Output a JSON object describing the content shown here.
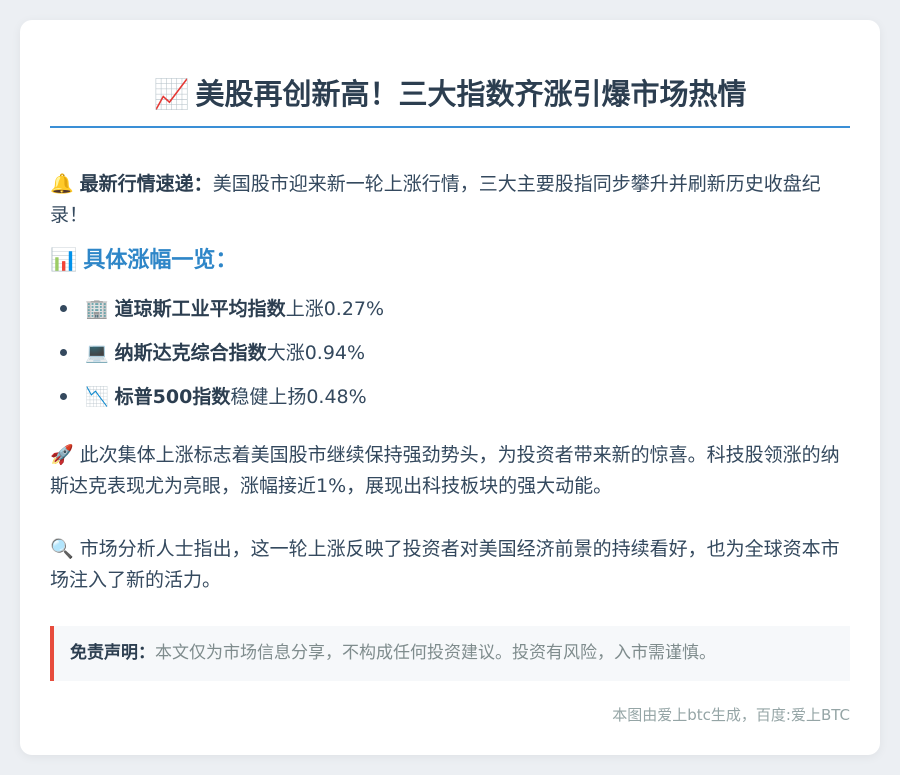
{
  "title": {
    "emoji": "📈",
    "text": "美股再创新高！三大指数齐涨引爆市场热情"
  },
  "intro": {
    "emoji": "🔔",
    "lead": "最新行情速递：",
    "text": "美国股市迎来新一轮上涨行情，三大主要股指同步攀升并刷新历史收盘纪录！"
  },
  "section": {
    "emoji": "📊",
    "heading": "具体涨幅一览："
  },
  "indices": [
    {
      "emoji": "🏢",
      "name": "道琼斯工业平均指数",
      "change": "上涨0.27%"
    },
    {
      "emoji": "💻",
      "name": "纳斯达克综合指数",
      "change": "大涨0.94%"
    },
    {
      "emoji": "📉",
      "name": "标普500指数",
      "change": "稳健上扬0.48%"
    }
  ],
  "paragraph1": {
    "emoji": "🚀",
    "text": "此次集体上涨标志着美国股市继续保持强劲势头，为投资者带来新的惊喜。科技股领涨的纳斯达克表现尤为亮眼，涨幅接近1%，展现出科技板块的强大动能。"
  },
  "paragraph2": {
    "emoji": "🔍",
    "text": "市场分析人士指出，这一轮上涨反映了投资者对美国经济前景的持续看好，也为全球资本市场注入了新的活力。"
  },
  "disclaimer": {
    "label": "免责声明：",
    "text": "本文仅为市场信息分享，不构成任何投资建议。投资有风险，入市需谨慎。"
  },
  "footer": "本图由爱上btc生成，百度:爱上BTC",
  "colors": {
    "accent": "#3a8fd6",
    "section_heading": "#2e86c8",
    "disclaimer_border": "#e74c3c"
  }
}
